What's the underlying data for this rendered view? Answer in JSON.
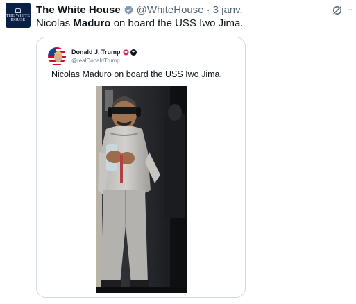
{
  "tweet": {
    "avatar_text": "THE WHITE HOUSE",
    "author_name": "The White House",
    "handle": "@WhiteHouse",
    "separator": "·",
    "timestamp": "3 janv.",
    "text_before": "Nicolas ",
    "text_bold": "Maduro",
    "text_after": " on board the USS Iwo Jima.",
    "more_label": "··",
    "accent_color": "#1d9bf0"
  },
  "embed": {
    "author_name": "Donald J. Trump",
    "handle": "@realDonaldTrump",
    "text": "Nicolas Maduro on board the USS Iwo Jima.",
    "badge_symbol": "+",
    "photo_icon": "detainee-photo"
  },
  "colors": {
    "text": "#0f1419",
    "secondary": "#536471",
    "border": "#cfd9de",
    "verified_gold": "#e8b23a",
    "heart_pink": "#e0245e",
    "avatar_navy": "#0a1f44"
  }
}
